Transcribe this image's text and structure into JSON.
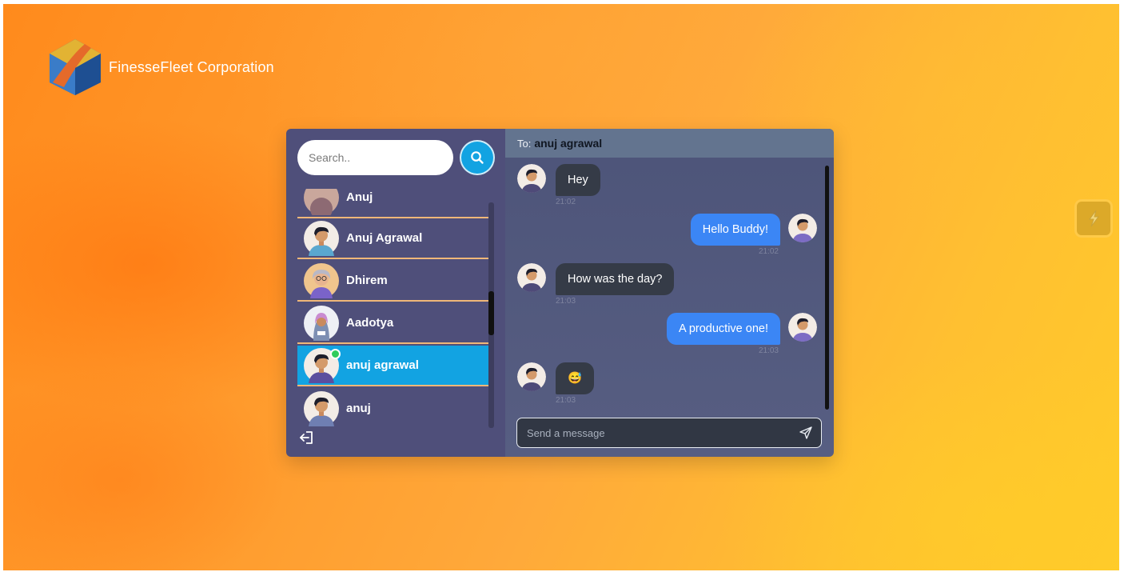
{
  "brand": {
    "name": "FinesseFleet Corporation",
    "logo_icon": "hexagon-cube-logo"
  },
  "search": {
    "placeholder": "Search..",
    "button_icon": "search-icon"
  },
  "contacts": [
    {
      "name": "Anuj",
      "active": false,
      "online": false
    },
    {
      "name": "Anuj Agrawal",
      "active": false,
      "online": false
    },
    {
      "name": "Dhirem",
      "active": false,
      "online": false
    },
    {
      "name": "Aadotya",
      "active": false,
      "online": false
    },
    {
      "name": "anuj agrawal",
      "active": true,
      "online": true
    },
    {
      "name": "anuj",
      "active": false,
      "online": false
    }
  ],
  "sidebar": {
    "logout_icon": "logout-icon"
  },
  "chat": {
    "to_label": "To:",
    "to_name": "anuj agrawal",
    "messages": [
      {
        "direction": "in",
        "text": "Hey",
        "time": "21:02"
      },
      {
        "direction": "out",
        "text": "Hello Buddy!",
        "time": "21:02"
      },
      {
        "direction": "in",
        "text": "How was the day?",
        "time": "21:03"
      },
      {
        "direction": "out",
        "text": "A productive one!",
        "time": "21:03"
      },
      {
        "direction": "in",
        "text": "😅",
        "time": "21:03"
      }
    ],
    "composer_placeholder": "Send a message",
    "send_icon": "send-icon"
  },
  "colors": {
    "active_contact": "#12a3e2",
    "outgoing_bubble": "#3b86f5",
    "incoming_bubble": "#353b47",
    "sidebar_bg": "#4f4f7a",
    "header_bg": "#63748f"
  }
}
